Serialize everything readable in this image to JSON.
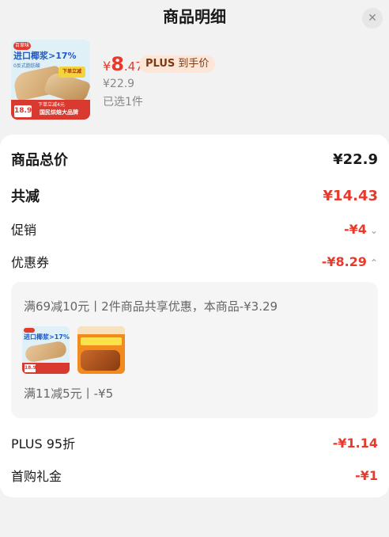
{
  "header": {
    "title": "商品明细",
    "close_icon": "close-icon"
  },
  "product": {
    "thumbnail": {
      "brand": "百草味",
      "headline": "进口椰浆>17%",
      "sub": "0反式脂肪酸",
      "tag": "下单立减",
      "strip_top": "下单立减4元",
      "strip_text": "国民烘焙大品牌",
      "price": "18.9"
    },
    "price_yen": "¥",
    "price_int": "8",
    "price_dec": ".47",
    "plus_badge_prefix": "PLUS",
    "plus_badge_suffix": "到手价",
    "original_price": "¥22.9",
    "selected_count": "已选1件"
  },
  "summary": {
    "total_label": "商品总价",
    "total_value": "¥22.9",
    "discount_label": "共减",
    "discount_value": "¥14.43",
    "promo_label": "促销",
    "promo_value": "-¥4",
    "coupon_label": "优惠券",
    "coupon_value": "-¥8.29",
    "coupon_detail": {
      "desc1": "满69减10元丨2件商品共享优惠，本商品-¥3.29",
      "desc2": "满11减5元丨-¥5"
    },
    "plus_label": "PLUS 95折",
    "plus_value": "-¥1.14",
    "first_label": "首购礼金",
    "first_value": "-¥1"
  },
  "colors": {
    "accent_red": "#e83a2c",
    "badge_bg": "#fde6d8",
    "page_bg": "#f2f2f2"
  }
}
